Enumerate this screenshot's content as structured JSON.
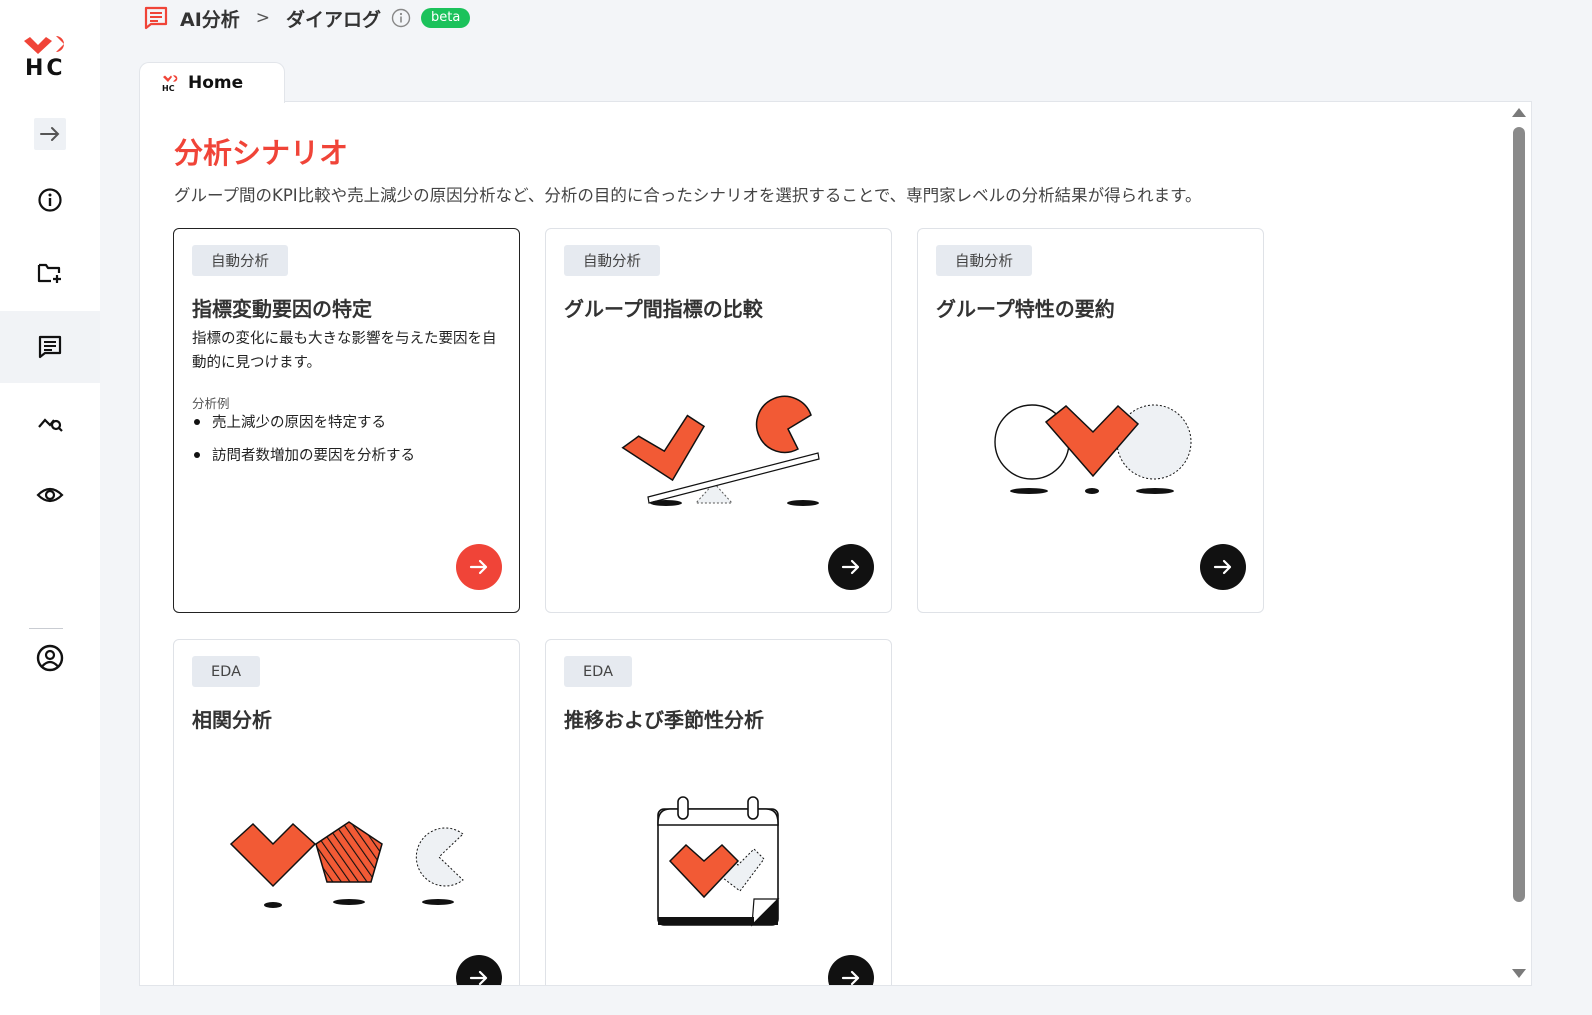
{
  "sidebar": {
    "logo_text": "HC",
    "items": [
      {
        "name": "expand",
        "icon": "arrow-right-icon"
      },
      {
        "name": "info",
        "icon": "info-icon"
      },
      {
        "name": "new-folder",
        "icon": "folder-plus-icon"
      },
      {
        "name": "dialog",
        "icon": "chat-icon",
        "active": true
      },
      {
        "name": "analysis",
        "icon": "chart-search-icon"
      },
      {
        "name": "view",
        "icon": "eye-icon"
      },
      {
        "name": "account",
        "icon": "user-circle-icon"
      }
    ]
  },
  "breadcrumb": {
    "root": "AI分析",
    "separator": ">",
    "current": "ダイアログ",
    "badge": "beta"
  },
  "tab": {
    "label": "Home"
  },
  "main": {
    "title": "分析シナリオ",
    "description": "グループ間のKPI比較や売上減少の原因分析など、分析の目的に合ったシナリオを選択することで、専門家レベルの分析結果が得られます。",
    "cards": [
      {
        "badge": "自動分析",
        "title": "指標変動要因の特定",
        "description": "指標の変化に最も大きな影響を与えた要因を自動的に見つけます。",
        "examples_label": "分析例",
        "examples": [
          "売上減少の原因を特定する",
          "訪問者数増加の要因を分析する"
        ]
      },
      {
        "badge": "自動分析",
        "title": "グループ間指標の比較"
      },
      {
        "badge": "自動分析",
        "title": "グループ特性の要約"
      },
      {
        "badge": "EDA",
        "title": "相関分析"
      },
      {
        "badge": "EDA",
        "title": "推移および季節性分析"
      }
    ]
  },
  "colors": {
    "accent": "#f04438",
    "beta": "#1bc25b",
    "illustration": "#f25a35"
  }
}
